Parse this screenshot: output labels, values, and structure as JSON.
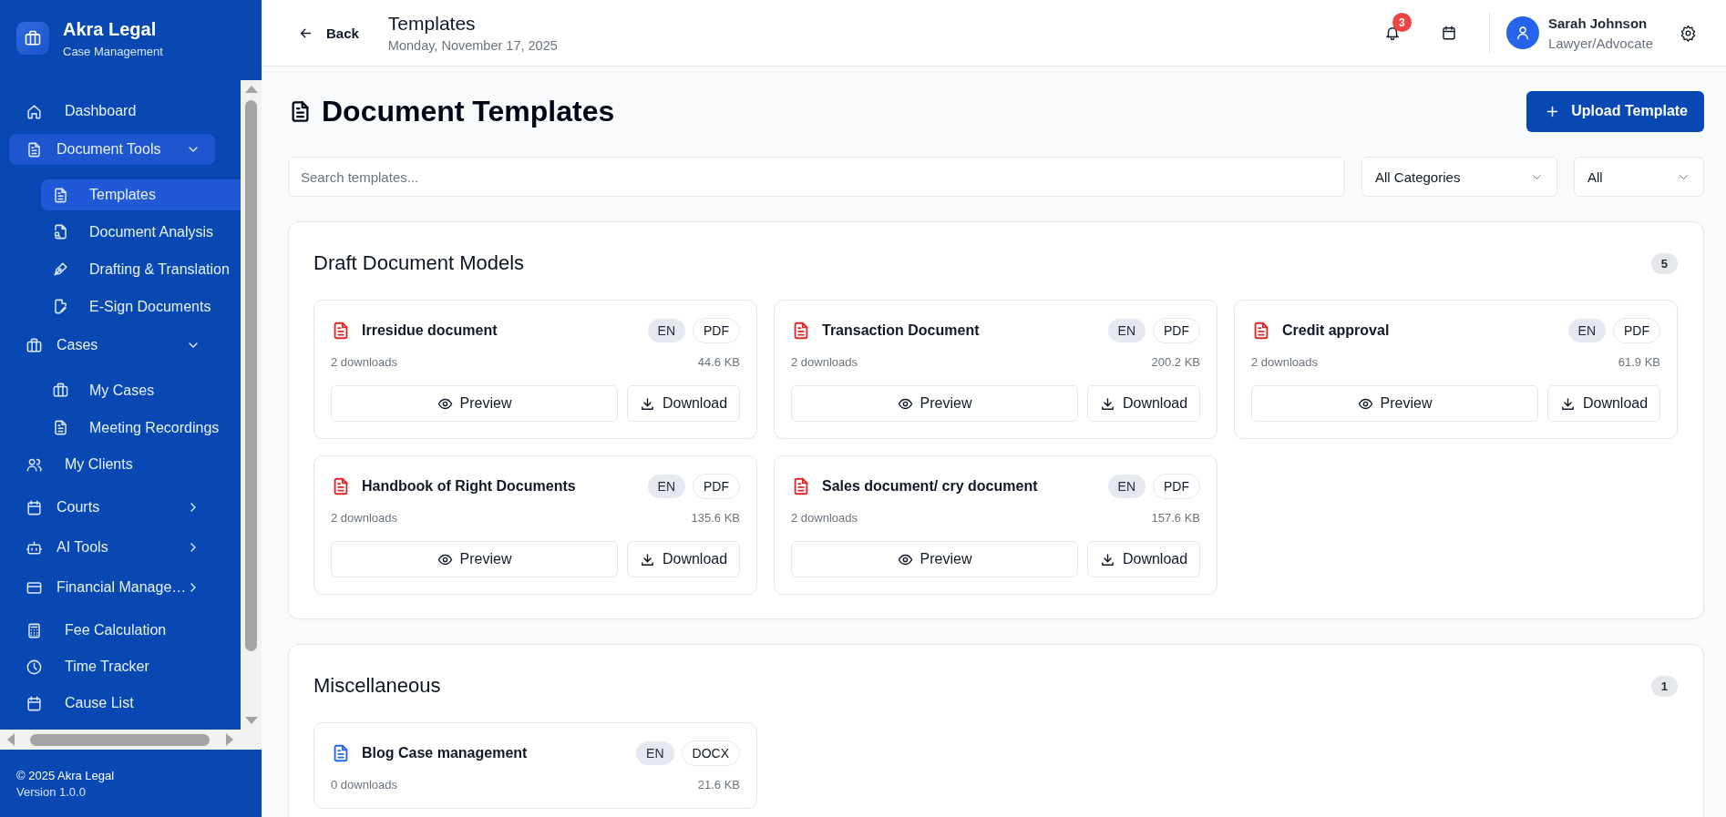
{
  "sidebar": {
    "brand": {
      "name": "Akra Legal",
      "subtitle": "Case Management"
    },
    "items": [
      {
        "label": "Dashboard",
        "selected": false
      },
      {
        "label": "Document Tools",
        "selected": true,
        "expanded": true,
        "children": [
          {
            "label": "Templates",
            "selected": true
          },
          {
            "label": "Document Analysis",
            "selected": false
          },
          {
            "label": "Drafting & Translation",
            "selected": false
          },
          {
            "label": "E-Sign Documents",
            "selected": false
          }
        ]
      },
      {
        "label": "Cases",
        "selected": false,
        "expanded": true,
        "children": [
          {
            "label": "My Cases",
            "selected": false
          },
          {
            "label": "Meeting Recordings",
            "selected": false
          }
        ]
      },
      {
        "label": "My Clients",
        "selected": false
      },
      {
        "label": "Courts",
        "selected": false,
        "expanded": false
      },
      {
        "label": "AI Tools",
        "selected": false,
        "expanded": false
      },
      {
        "label": "Financial Manage…",
        "selected": false,
        "expanded": false
      },
      {
        "label": "Fee Calculation",
        "selected": false
      },
      {
        "label": "Time Tracker",
        "selected": false
      },
      {
        "label": "Cause List",
        "selected": false
      }
    ],
    "footer": {
      "copyright": "© 2025 Akra Legal",
      "version": "Version 1.0.0"
    }
  },
  "header": {
    "back": "Back",
    "title": "Templates",
    "date": "Monday, November 17, 2025",
    "notifications": "3",
    "user": {
      "name": "Sarah Johnson",
      "role": "Lawyer/Advocate"
    }
  },
  "page": {
    "title": "Document Templates",
    "upload_button": "Upload Template",
    "search": {
      "placeholder": "Search templates..."
    },
    "filters": [
      {
        "value": "All Categories"
      },
      {
        "value": "All"
      }
    ]
  },
  "sections": [
    {
      "title": "Draft Document Models",
      "count": "5",
      "templates": [
        {
          "title": "Irresidue document",
          "language": "EN",
          "format": "PDF",
          "color": "#dc2626",
          "downloads": "2 downloads",
          "size": "44.6 KB",
          "actions": [
            {
              "kind": "preview",
              "label": "Preview"
            },
            {
              "kind": "download",
              "label": "Download"
            }
          ]
        },
        {
          "title": "Transaction Document",
          "language": "EN",
          "format": "PDF",
          "color": "#dc2626",
          "downloads": "2 downloads",
          "size": "200.2 KB",
          "actions": [
            {
              "kind": "preview",
              "label": "Preview"
            },
            {
              "kind": "download",
              "label": "Download"
            }
          ]
        },
        {
          "title": "Credit approval",
          "language": "EN",
          "format": "PDF",
          "color": "#dc2626",
          "downloads": "2 downloads",
          "size": "61.9 KB",
          "actions": [
            {
              "kind": "preview",
              "label": "Preview"
            },
            {
              "kind": "download",
              "label": "Download"
            }
          ]
        },
        {
          "title": "Handbook of Right Documents",
          "language": "EN",
          "format": "PDF",
          "color": "#dc2626",
          "downloads": "2 downloads",
          "size": "135.6 KB",
          "actions": [
            {
              "kind": "preview",
              "label": "Preview"
            },
            {
              "kind": "download",
              "label": "Download"
            }
          ]
        },
        {
          "title": "Sales document/ cry document",
          "language": "EN",
          "format": "PDF",
          "color": "#dc2626",
          "downloads": "2 downloads",
          "size": "157.6 KB",
          "actions": [
            {
              "kind": "preview",
              "label": "Preview"
            },
            {
              "kind": "download",
              "label": "Download"
            }
          ]
        }
      ]
    },
    {
      "title": "Miscellaneous",
      "count": "1",
      "templates": [
        {
          "title": "Blog Case management",
          "language": "EN",
          "format": "DOCX",
          "color": "#2563eb",
          "downloads": "0 downloads",
          "size": "21.6 KB"
        }
      ]
    }
  ]
}
